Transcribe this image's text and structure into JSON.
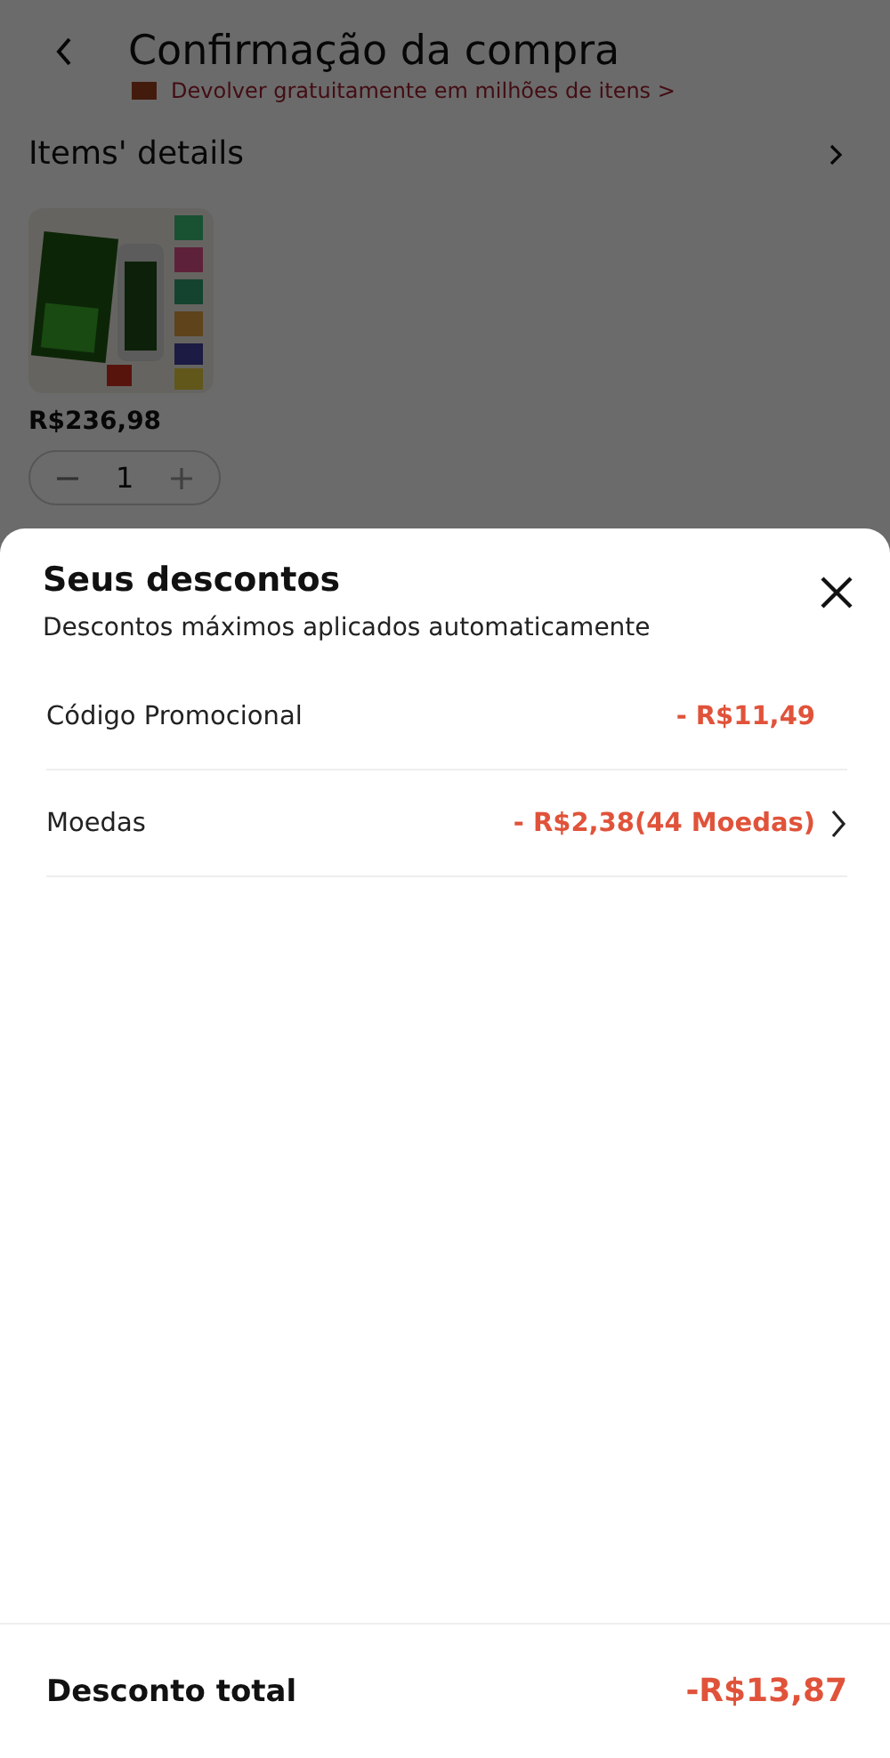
{
  "header": {
    "title": "Confirmação da compra"
  },
  "return_banner": {
    "text": "Devolver gratuitamente em milhões de itens >"
  },
  "items": {
    "title": "Items' details",
    "products": [
      {
        "kind": "picture",
        "price": "R$236,98",
        "quantity": "1"
      }
    ]
  },
  "sheet": {
    "title": "Seus descontos",
    "subtitle": "Descontos máximos aplicados automaticamente",
    "discounts": [
      {
        "label": "Código Promocional",
        "amount": "- R$11,49",
        "expandable": false
      },
      {
        "label": "Moedas",
        "amount": "- R$2,38(44 Moedas)",
        "expandable": true
      }
    ],
    "total": {
      "label": "Desconto total",
      "amount": "-R$13,87"
    }
  }
}
